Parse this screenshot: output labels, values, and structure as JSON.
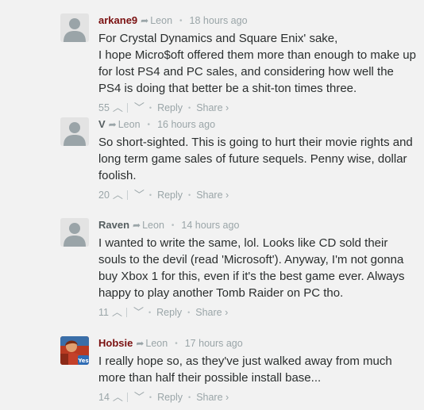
{
  "comments": [
    {
      "author": "arkane9",
      "author_color": "#7a1010",
      "parent": "Leon",
      "time": "18 hours ago",
      "lines": [
        "For Crystal Dynamics and Square Enix' sake,",
        "I hope Micro$oft offered them more than enough to make up for lost PS4 and PC sales, and considering how well the PS4 is doing that better be a shit-ton times three."
      ],
      "votes": "55",
      "reply": "Reply",
      "share": "Share ›",
      "avatar": "default-avatar"
    },
    {
      "author": "V",
      "author_color": "#555e60",
      "parent": "Leon",
      "time": "16 hours ago",
      "lines": [
        "So short-sighted. This is going to hurt their movie rights and long term game sales of future sequels. Penny wise, dollar foolish."
      ],
      "votes": "20",
      "reply": "Reply",
      "share": "Share ›",
      "avatar": "default-avatar"
    },
    {
      "author": "Raven",
      "author_color": "#555e60",
      "parent": "Leon",
      "time": "14 hours ago",
      "lines": [
        "I wanted to write the same, lol. Looks like CD sold their souls to the devil (read 'Microsoft'). Anyway, I'm not gonna buy Xbox 1 for this, even if it's the best game ever. Always happy to play another Tomb Raider on PC tho."
      ],
      "votes": "11",
      "reply": "Reply",
      "share": "Share ›",
      "avatar": "default-avatar"
    },
    {
      "author": "Hobsie",
      "author_color": "#7a1010",
      "parent": "Leon",
      "time": "17 hours ago",
      "lines": [
        "I really hope so, as they've just walked away from much more than half their possible install base..."
      ],
      "votes": "14",
      "reply": "Reply",
      "share": "Share ›",
      "avatar": "photo-avatar",
      "avatar_badge": "Yes"
    }
  ],
  "icons": {
    "reply_arrow": "reply-arrow-icon",
    "upvote": "chevron-up-icon",
    "downvote": "chevron-down-icon"
  }
}
